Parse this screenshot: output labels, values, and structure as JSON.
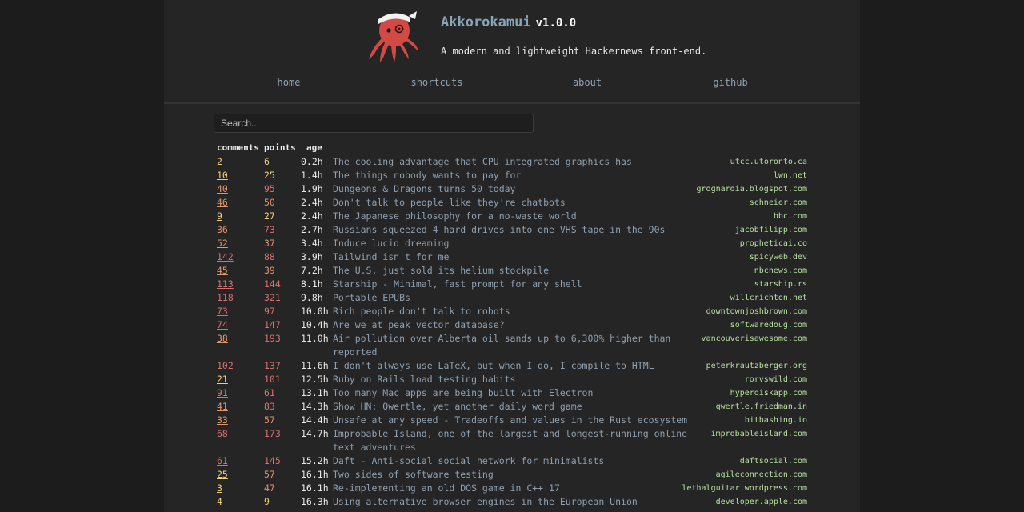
{
  "header": {
    "title": "Akkorokamui",
    "version": "v1.0.0",
    "tagline": "A modern and lightweight Hackernews front-end."
  },
  "nav": [
    "home",
    "shortcuts",
    "about",
    "github"
  ],
  "search": {
    "placeholder": "Search..."
  },
  "columns": {
    "comments": "comments",
    "points": "points",
    "age": "age"
  },
  "colors": {
    "low": "#f2cf7c",
    "mid": "#e4946a",
    "high": "#d9706f",
    "domain": "#b7e0a0",
    "title_link": "#8ea0b0",
    "logo": "#d24a43"
  },
  "stories": [
    {
      "comments": "2",
      "points": "6",
      "age": "0.2h",
      "title": "The cooling advantage that CPU integrated graphics has",
      "domain": "utcc.utoronto.ca"
    },
    {
      "comments": "10",
      "points": "25",
      "age": "1.4h",
      "title": "The things nobody wants to pay for",
      "domain": "lwn.net"
    },
    {
      "comments": "40",
      "points": "95",
      "age": "1.9h",
      "title": "Dungeons & Dragons turns 50 today",
      "domain": "grognardia.blogspot.com"
    },
    {
      "comments": "46",
      "points": "50",
      "age": "2.4h",
      "title": "Don't talk to people like they're chatbots",
      "domain": "schneier.com"
    },
    {
      "comments": "9",
      "points": "27",
      "age": "2.4h",
      "title": "The Japanese philosophy for a no-waste world",
      "domain": "bbc.com"
    },
    {
      "comments": "36",
      "points": "73",
      "age": "2.7h",
      "title": "Russians squeezed 4 hard drives into one VHS tape in the 90s",
      "domain": "jacobfilipp.com"
    },
    {
      "comments": "52",
      "points": "37",
      "age": "3.4h",
      "title": "Induce lucid dreaming",
      "domain": "propheticai.co"
    },
    {
      "comments": "142",
      "points": "88",
      "age": "3.9h",
      "title": "Tailwind isn't for me",
      "domain": "spicyweb.dev"
    },
    {
      "comments": "45",
      "points": "39",
      "age": "7.2h",
      "title": "The U.S. just sold its helium stockpile",
      "domain": "nbcnews.com"
    },
    {
      "comments": "113",
      "points": "144",
      "age": "8.1h",
      "title": "Starship - Minimal, fast prompt for any shell",
      "domain": "starship.rs"
    },
    {
      "comments": "118",
      "points": "321",
      "age": "9.8h",
      "title": "Portable EPUBs",
      "domain": "willcrichton.net"
    },
    {
      "comments": "73",
      "points": "97",
      "age": "10.0h",
      "title": "Rich people don't talk to robots",
      "domain": "downtownjoshbrown.com"
    },
    {
      "comments": "74",
      "points": "147",
      "age": "10.4h",
      "title": "Are we at peak vector database?",
      "domain": "softwaredoug.com"
    },
    {
      "comments": "38",
      "points": "193",
      "age": "11.0h",
      "title": "Air pollution over Alberta oil sands up to 6,300% higher than reported",
      "domain": "vancouverisawesome.com"
    },
    {
      "comments": "102",
      "points": "137",
      "age": "11.6h",
      "title": "I don't always use LaTeX, but when I do, I compile to HTML",
      "domain": "peterkrautzberger.org"
    },
    {
      "comments": "21",
      "points": "101",
      "age": "12.5h",
      "title": "Ruby on Rails load testing habits",
      "domain": "rorvswild.com"
    },
    {
      "comments": "91",
      "points": "61",
      "age": "13.1h",
      "title": "Too many Mac apps are being built with Electron",
      "domain": "hyperdiskapp.com"
    },
    {
      "comments": "41",
      "points": "83",
      "age": "14.3h",
      "title": "Show HN: Qwertle, yet another daily word game",
      "domain": "qwertle.friedman.in"
    },
    {
      "comments": "33",
      "points": "57",
      "age": "14.4h",
      "title": "Unsafe at any speed - Tradeoffs and values in the Rust ecosystem",
      "domain": "bitbashing.io"
    },
    {
      "comments": "68",
      "points": "173",
      "age": "14.7h",
      "title": "Improbable Island, one of the largest and longest-running online text adventures",
      "domain": "improbableisland.com"
    },
    {
      "comments": "61",
      "points": "145",
      "age": "15.2h",
      "title": "Daft - Anti-social social network for minimalists",
      "domain": "daftsocial.com"
    },
    {
      "comments": "25",
      "points": "57",
      "age": "16.1h",
      "title": "Two sides of software testing",
      "domain": "agileconnection.com"
    },
    {
      "comments": "3",
      "points": "47",
      "age": "16.1h",
      "title": "Re-implementing an old DOS game in C++ 17",
      "domain": "lethalguitar.wordpress.com"
    },
    {
      "comments": "4",
      "points": "9",
      "age": "16.3h",
      "title": "Using alternative browser engines in the European Union",
      "domain": "developer.apple.com"
    }
  ]
}
